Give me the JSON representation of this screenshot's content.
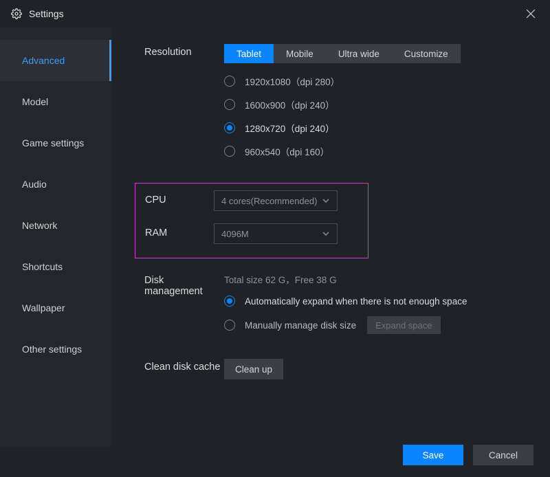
{
  "window": {
    "title": "Settings"
  },
  "sidebar": {
    "items": [
      {
        "label": "Advanced",
        "active": true
      },
      {
        "label": "Model"
      },
      {
        "label": "Game settings"
      },
      {
        "label": "Audio"
      },
      {
        "label": "Network"
      },
      {
        "label": "Shortcuts"
      },
      {
        "label": "Wallpaper"
      },
      {
        "label": "Other settings"
      }
    ]
  },
  "resolution": {
    "label": "Resolution",
    "tabs": [
      {
        "label": "Tablet",
        "active": true
      },
      {
        "label": "Mobile"
      },
      {
        "label": "Ultra wide"
      },
      {
        "label": "Customize"
      }
    ],
    "options": [
      {
        "label": "1920x1080（dpi 280）",
        "selected": false
      },
      {
        "label": "1600x900（dpi 240）",
        "selected": false
      },
      {
        "label": "1280x720（dpi 240）",
        "selected": true
      },
      {
        "label": "960x540（dpi 160）",
        "selected": false
      }
    ]
  },
  "cpu": {
    "label": "CPU",
    "value": "4 cores(Recommended)"
  },
  "ram": {
    "label": "RAM",
    "value": "4096M"
  },
  "disk": {
    "label": "Disk management",
    "info": "Total size 62 G，Free 38 G",
    "options": [
      {
        "label": "Automatically expand when there is not enough space",
        "selected": true
      },
      {
        "label": "Manually manage disk size",
        "selected": false
      }
    ],
    "expand_button": "Expand space"
  },
  "clean": {
    "label": "Clean disk cache",
    "button": "Clean up"
  },
  "footer": {
    "save": "Save",
    "cancel": "Cancel"
  }
}
